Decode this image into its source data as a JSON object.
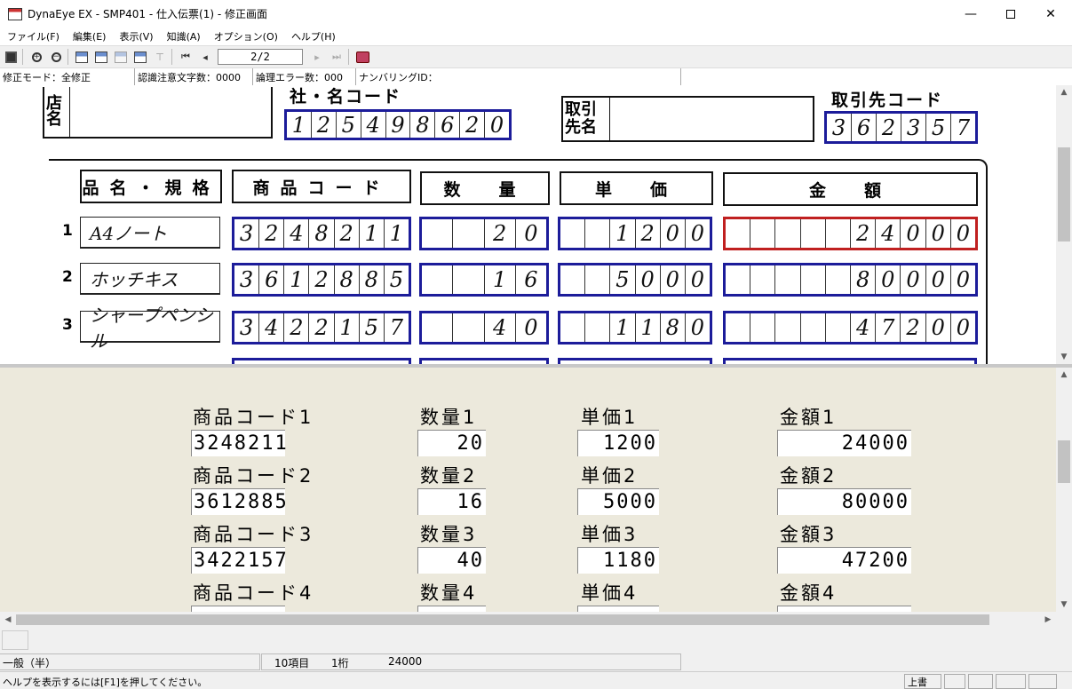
{
  "window": {
    "title": "DynaEye EX - SMP401 - 仕入伝票(1) - 修正画面",
    "minimize": "—",
    "close": "✕"
  },
  "menu": [
    "ファイル(F)",
    "編集(E)",
    "表示(V)",
    "知識(A)",
    "オプション(O)",
    "ヘルプ(H)"
  ],
  "toolbar": {
    "page": "2/2"
  },
  "info": {
    "mode": "修正モード：全修正",
    "caution": "認識注意文字数：0000",
    "logic_error": "論理エラー数：000",
    "numbering": "ナンバリングID："
  },
  "form": {
    "store_label": "店名",
    "company_code_label": "社・名コード",
    "company_code": [
      "1",
      "2",
      "5",
      "4",
      "9",
      "8",
      "6",
      "2",
      "0"
    ],
    "partner_label": "取引先名",
    "partner_code_label": "取引先コード",
    "partner_code": [
      "3",
      "6",
      "2",
      "3",
      "5",
      "7"
    ],
    "headers": [
      "品名・規格",
      "商品コード",
      "数　量",
      "単　価",
      "金　額"
    ],
    "rows": [
      {
        "num": "1",
        "name": "A4ノート",
        "code": [
          "3",
          "2",
          "4",
          "8",
          "2",
          "1",
          "1"
        ],
        "qty": [
          "",
          "",
          "2",
          "0"
        ],
        "price": [
          "",
          "",
          "1",
          "2",
          "0",
          "0"
        ],
        "amount": [
          "",
          "",
          "",
          "",
          "",
          "2",
          "4",
          "0",
          "0",
          "0"
        ]
      },
      {
        "num": "2",
        "name": "ホッチキス",
        "code": [
          "3",
          "6",
          "1",
          "2",
          "8",
          "8",
          "5"
        ],
        "qty": [
          "",
          "",
          "1",
          "6"
        ],
        "price": [
          "",
          "",
          "5",
          "0",
          "0",
          "0"
        ],
        "amount": [
          "",
          "",
          "",
          "",
          "",
          "8",
          "0",
          "0",
          "0",
          "0"
        ]
      },
      {
        "num": "3",
        "name": "シャープペンシル",
        "code": [
          "3",
          "4",
          "2",
          "2",
          "1",
          "5",
          "7"
        ],
        "qty": [
          "",
          "",
          "4",
          "0"
        ],
        "price": [
          "",
          "",
          "1",
          "1",
          "8",
          "0"
        ],
        "amount": [
          "",
          "",
          "",
          "",
          "",
          "4",
          "7",
          "2",
          "0",
          "0"
        ]
      }
    ]
  },
  "entry": {
    "rows": [
      {
        "code_label": "商品コード1",
        "code": "3248211",
        "qty_label": "数量1",
        "qty": "20",
        "price_label": "単価1",
        "price": "1200",
        "amount_label": "金額1",
        "amount": "24000"
      },
      {
        "code_label": "商品コード2",
        "code": "3612885",
        "qty_label": "数量2",
        "qty": "16",
        "price_label": "単価2",
        "price": "5000",
        "amount_label": "金額2",
        "amount": "80000"
      },
      {
        "code_label": "商品コード3",
        "code": "3422157",
        "qty_label": "数量3",
        "qty": "40",
        "price_label": "単価3",
        "price": "1180",
        "amount_label": "金額3",
        "amount": "47200"
      },
      {
        "code_label": "商品コード4",
        "code": "",
        "qty_label": "数量4",
        "qty": "",
        "price_label": "単価4",
        "price": "",
        "amount_label": "金額4",
        "amount": ""
      }
    ]
  },
  "status": {
    "type": "一般（半）",
    "items": "10項目",
    "digits": "1桁",
    "value": "24000",
    "help": "ヘルプを表示するには[F1]を押してください。",
    "overwrite": "上書"
  },
  "colors": {
    "box_blue": "#1c1c9a",
    "box_red": "#c02020",
    "entry_bg": "#ece9dc"
  }
}
